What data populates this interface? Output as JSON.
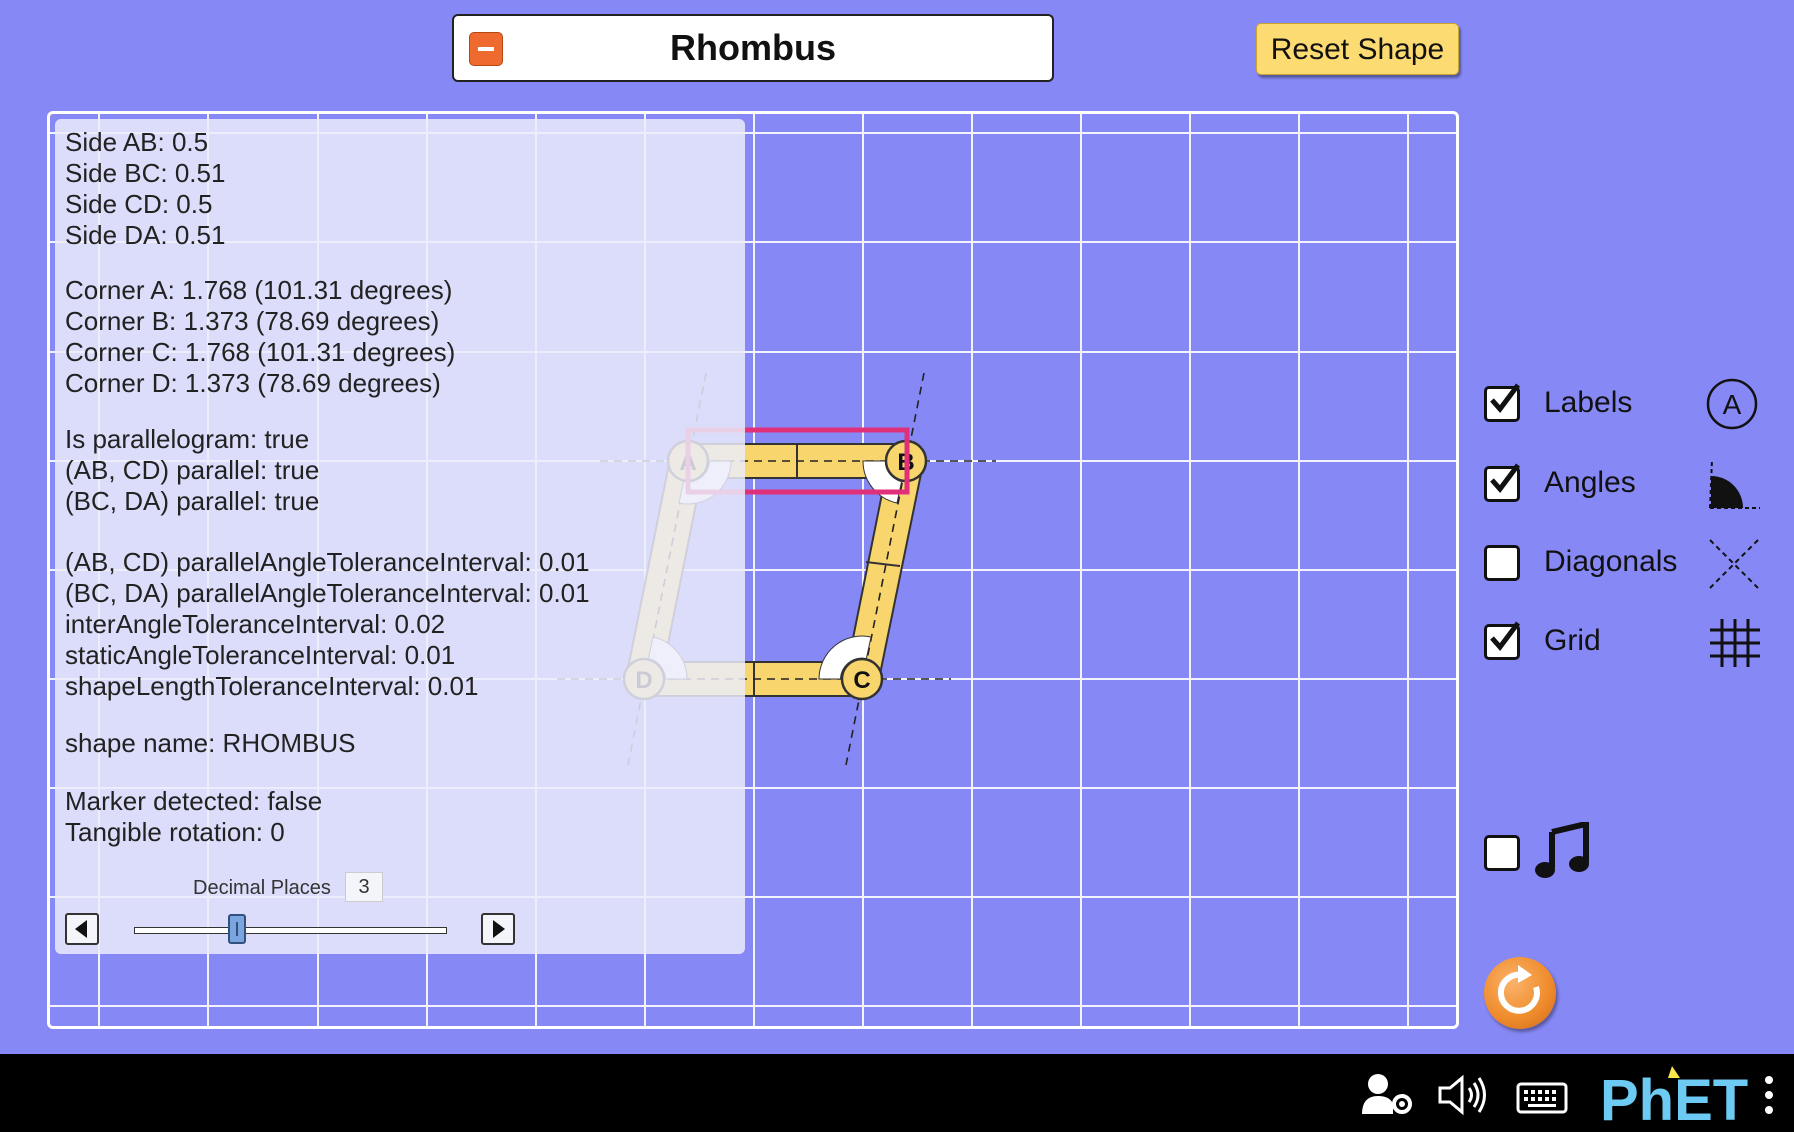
{
  "title_panel": {
    "shape_name_title": "Rhombus"
  },
  "buttons": {
    "reset_shape": "Reset Shape"
  },
  "info": {
    "side_ab": "Side AB: 0.5",
    "side_bc": "Side BC: 0.51",
    "side_cd": "Side CD: 0.5",
    "side_da": "Side DA: 0.51",
    "corner_a": "Corner A: 1.768 (101.31 degrees)",
    "corner_b": "Corner B: 1.373 (78.69 degrees)",
    "corner_c": "Corner C: 1.768 (101.31 degrees)",
    "corner_d": "Corner D: 1.373 (78.69 degrees)",
    "is_parallelogram": "Is parallelogram: true",
    "ab_cd_parallel": "(AB, CD) parallel: true",
    "bc_da_parallel": "(BC, DA) parallel: true",
    "ab_cd_tolerance": "(AB, CD) parallelAngleToleranceInterval: 0.01",
    "bc_da_tolerance": "(BC, DA) parallelAngleToleranceInterval: 0.01",
    "inter_angle_tolerance": "interAngleToleranceInterval: 0.02",
    "static_angle_tolerance": "staticAngleToleranceInterval: 0.01",
    "shape_length_tolerance": "shapeLengthToleranceInterval: 0.01",
    "shape_name": "shape name: RHOMBUS",
    "marker_detected": "Marker detected: false",
    "tangible_rotation": "Tangible rotation: 0",
    "decimal_places_label": "Decimal Places",
    "decimal_places_value": "3"
  },
  "vertices": {
    "a": "A",
    "b": "B",
    "c": "C",
    "d": "D"
  },
  "controls": {
    "labels": {
      "label": "Labels",
      "checked": true,
      "icon_text": "A"
    },
    "angles": {
      "label": "Angles",
      "checked": true
    },
    "diagonals": {
      "label": "Diagonals",
      "checked": false
    },
    "grid": {
      "label": "Grid",
      "checked": true
    },
    "sound": {
      "checked": false
    }
  },
  "navbar": {
    "brand": "PhET"
  },
  "colors": {
    "background": "#8688f5",
    "shape_fill": "#f9d56e",
    "highlight": "#e0307a"
  }
}
